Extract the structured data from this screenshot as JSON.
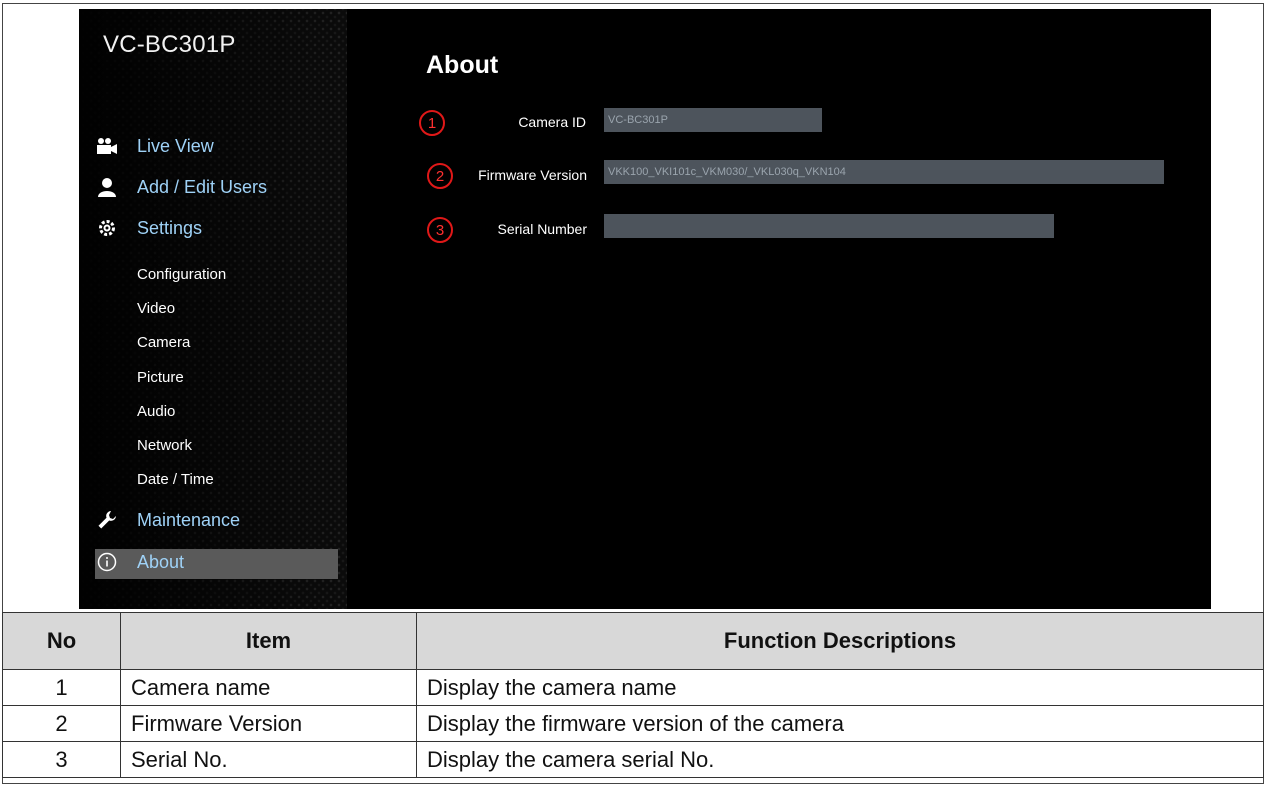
{
  "sidebar": {
    "model": "VC-BC301P",
    "main_items": [
      {
        "label": "Live View",
        "icon": "camera-icon"
      },
      {
        "label": "Add / Edit Users",
        "icon": "user-icon"
      },
      {
        "label": "Settings",
        "icon": "gear-icon"
      }
    ],
    "sub_items": [
      "Configuration",
      "Video",
      "Camera",
      "Picture",
      "Audio",
      "Network",
      "Date / Time"
    ],
    "maintenance": {
      "label": "Maintenance",
      "icon": "wrench-icon"
    },
    "about": {
      "label": "About",
      "icon": "info-icon"
    }
  },
  "content": {
    "title": "About",
    "fields": [
      {
        "num": "1",
        "label": "Camera ID",
        "value": "VC-BC301P"
      },
      {
        "num": "2",
        "label": "Firmware Version",
        "value": "VKK100_VKI101c_VKM030/_VKL030q_VKN104"
      },
      {
        "num": "3",
        "label": "Serial Number",
        "value": ""
      }
    ]
  },
  "table": {
    "headers": [
      "No",
      "Item",
      "Function Descriptions"
    ],
    "rows": [
      [
        "1",
        "Camera name",
        "Display the camera name"
      ],
      [
        "2",
        "Firmware Version",
        "Display the firmware version of the camera"
      ],
      [
        "3",
        "Serial No.",
        "Display the camera serial No."
      ]
    ]
  },
  "colors": {
    "accent_blue": "#9fd2f7",
    "marker_red": "#e01818",
    "field_bg": "#4d545c"
  }
}
